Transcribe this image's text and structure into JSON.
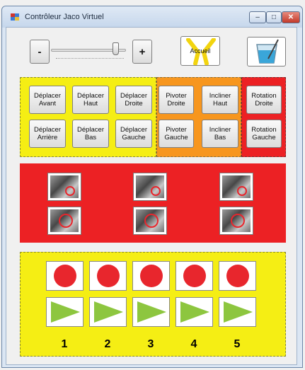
{
  "window": {
    "title": "Contrôleur Jaco Virtuel",
    "minimize": "–",
    "maximize": "□",
    "close": "✕"
  },
  "toolbar": {
    "minus_label": "-",
    "plus_label": "+",
    "accueil_label": "Accueil",
    "slider_value_fraction": 0.9
  },
  "move_group": {
    "color": "#f5ee14",
    "buttons": [
      {
        "line1": "Déplacer",
        "line2": "Avant"
      },
      {
        "line1": "Déplacer",
        "line2": "Haut"
      },
      {
        "line1": "Déplacer",
        "line2": "Droite"
      },
      {
        "line1": "Déplacer",
        "line2": "Arrière"
      },
      {
        "line1": "Déplacer",
        "line2": "Bas"
      },
      {
        "line1": "Déplacer",
        "line2": "Gauche"
      }
    ]
  },
  "pivot_group": {
    "color": "#f7961e",
    "buttons": [
      {
        "line1": "Pivoter",
        "line2": "Droite"
      },
      {
        "line1": "Incliner",
        "line2": "Haut"
      },
      {
        "line1": "Pivoter",
        "line2": "Gauche"
      },
      {
        "line1": "Incliner",
        "line2": "Bas"
      }
    ]
  },
  "rotation_group": {
    "color": "#ec2124",
    "buttons": [
      {
        "line1": "Rotation",
        "line2": "Droite"
      },
      {
        "line1": "Rotation",
        "line2": "Gauche"
      }
    ]
  },
  "gripper_group": {
    "color": "#ec2124"
  },
  "positions_group": {
    "color": "#f5ee14",
    "numbers": [
      "1",
      "2",
      "3",
      "4",
      "5"
    ],
    "dot_color": "#e8262d",
    "play_color": "#8dc63f"
  }
}
